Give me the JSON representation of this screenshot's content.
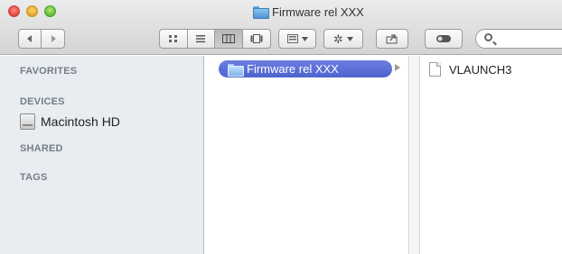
{
  "window": {
    "title": "Firmware rel XXX"
  },
  "toolbar": {
    "back_icon": "chevron-left-icon",
    "forward_icon": "chevron-right-icon",
    "view_modes": [
      "icon-view",
      "list-view",
      "column-view",
      "cover-flow-view"
    ],
    "active_view": "column-view",
    "arrange_icon": "arrange-grid-icon",
    "action_icon": "gear-icon",
    "share_icon": "share-icon",
    "tags_icon": "tag-toggle-icon",
    "search_placeholder": ""
  },
  "sidebar": {
    "favorites_header": "FAVORITES",
    "devices_header": "DEVICES",
    "device_item": "Macintosh HD",
    "shared_header": "SHARED",
    "tags_header": "TAGS"
  },
  "columns": {
    "col1_selected": "Firmware rel XXX",
    "col2_file": "VLAUNCH3"
  },
  "colors": {
    "selection": "#5b6fd6",
    "sidebar_bg": "#e8edf2"
  }
}
